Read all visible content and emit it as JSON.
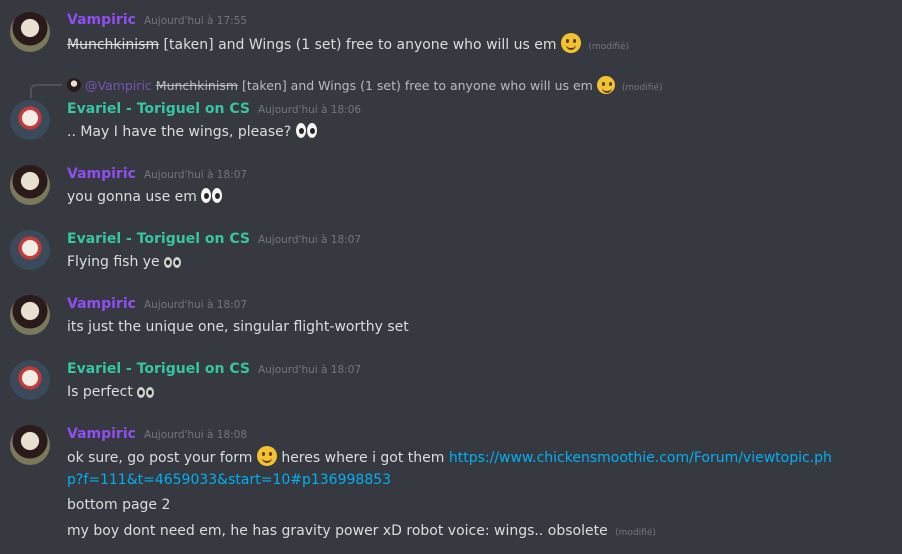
{
  "colors": {
    "background": "#36393f",
    "vampiric": "#8f4ff0",
    "evariel": "#35c6a2",
    "link": "#00b0f4",
    "timestamp": "#72767d"
  },
  "messages": [
    {
      "author": "Vampiric",
      "time": "Aujourd'hui à 17:55",
      "strike_text": "Munchkinism",
      "text": " [taken] and Wings (1 set) free to anyone who will us em",
      "emoji": "slightly-smiling-face",
      "edited": "(modifié)"
    },
    {
      "reply": {
        "mention": "@Vampiric",
        "strike_text": "Munchkinism",
        "text": " [taken] and Wings (1 set) free to anyone who will us em",
        "edited": "(modifié)"
      },
      "author": "Evariel - Toriguel on CS",
      "time": "Aujourd'hui à 18:06",
      "text": ".. May I have the wings, please?",
      "emoji": "eyes"
    },
    {
      "author": "Vampiric",
      "time": "Aujourd'hui à 18:07",
      "text": "you gonna use em",
      "emoji": "eyes"
    },
    {
      "author": "Evariel - Toriguel on CS",
      "time": "Aujourd'hui à 18:07",
      "text": "Flying fish ye",
      "emoji": "eyes"
    },
    {
      "author": "Vampiric",
      "time": "Aujourd'hui à 18:07",
      "text": "its just the unique one, singular flight-worthy set"
    },
    {
      "author": "Evariel - Toriguel on CS",
      "time": "Aujourd'hui à 18:07",
      "text": "Is perfect",
      "emoji": "eyes"
    },
    {
      "author": "Vampiric",
      "time": "Aujourd'hui à 18:08",
      "text_before": "ok sure, go post your form",
      "text_after": " heres where i got them ",
      "link": "https://www.chickensmoothie.com/Forum/viewtopic.php?f=111&t=4659033&start=10#p136998853",
      "line2": "bottom page 2",
      "line3": "my boy dont need em, he has gravity power xD robot voice: wings.. obsolete",
      "edited": "(modifié)"
    }
  ]
}
